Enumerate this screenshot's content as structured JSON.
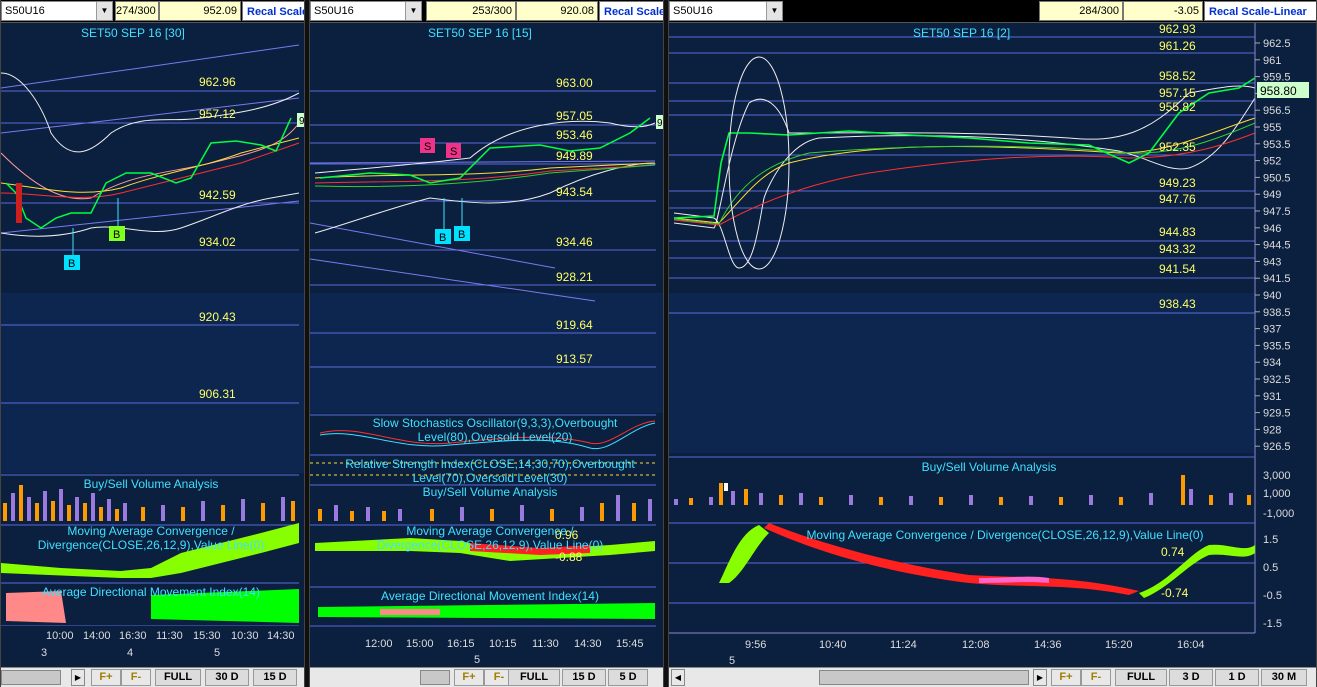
{
  "colors": {
    "background": "#0b1f3f",
    "grid_line": "#5a6ad8",
    "level_text": "#ffff66",
    "label_cyan": "#40e0ff",
    "price_line": "#00ff40",
    "bollinger": "#ffffff",
    "ma_yellow": "#ffdd33",
    "ma_red": "#ff3030",
    "ma_green": "#30d030",
    "volume_buy": "#ff9900",
    "volume_sell": "#9a7adf",
    "macd_green": "#88ff00",
    "macd_red": "#ff2020",
    "adx_green": "#00ff00",
    "adx_red": "#ff8888"
  },
  "panels": [
    {
      "id": "p1",
      "symbol": "S50U16",
      "bar_count": "274/300",
      "last_price": "952.09",
      "recal_label": "Recal Scale",
      "title": "SET50 SEP 16  [30]",
      "price_levels": [
        "962.96",
        "957.12",
        "942.59",
        "934.02",
        "920.43",
        "906.31"
      ],
      "badge_edge": "9",
      "markers": [
        "B",
        "B"
      ],
      "volume_label": "Buy/Sell Volume Analysis",
      "macd_label": "Moving Average Convergence / Divergence(CLOSE,26,12,9),Value Line(0)",
      "adx_label": "Average Directional Movement Index(14)",
      "time_labels": [
        "10:00",
        "14:00",
        "16:30",
        "11:30",
        "15:30",
        "10:30",
        "14:30"
      ],
      "date_labels": [
        "3",
        "4",
        "5"
      ],
      "buttons": [
        "F+",
        "F-",
        "FULL",
        "30 D",
        "15 D"
      ]
    },
    {
      "id": "p2",
      "symbol": "S50U16",
      "bar_count": "253/300",
      "last_price": "920.08",
      "recal_label": "Recal Scale",
      "title": "SET50 SEP 16  [15]",
      "price_levels": [
        "963.00",
        "957.05",
        "953.46",
        "949.89",
        "943.54",
        "934.46",
        "928.21",
        "919.64",
        "913.57"
      ],
      "badge_edge": "9",
      "markers": [
        "S",
        "S",
        "B",
        "B"
      ],
      "stoch_label": "Slow Stochastics Oscillator(9,3,3),Overbought Level(80),Oversold Level(20)",
      "rsi_label": "Relative Strength Index(CLOSE,14,30,70),Overbought Level(70),Oversold Level(30)",
      "volume_label": "Buy/Sell Volume Analysis",
      "macd_label": "Moving Average Convergence / Divergence(CLOSE,26,12,9),Value Line(0)",
      "macd_values": [
        "0.96",
        "-0.88"
      ],
      "adx_label": "Average Directional Movement Index(14)",
      "time_labels": [
        "12:00",
        "15:00",
        "16:15",
        "10:15",
        "11:30",
        "14:30",
        "15:45"
      ],
      "date_labels": [
        "5"
      ],
      "buttons": [
        "F+",
        "F-",
        "FULL",
        "15 D",
        "5 D"
      ]
    },
    {
      "id": "p3",
      "symbol": "S50U16",
      "bar_count": "284/300",
      "last_price": "-3.05",
      "recal_label": "Recal Scale-Linear",
      "title": "SET50 SEP 16  [2]",
      "price_levels": [
        "962.93",
        "961.26",
        "958.52",
        "957.15",
        "955.82",
        "952.35",
        "949.23",
        "947.76",
        "944.83",
        "943.32",
        "941.54",
        "938.43"
      ],
      "current_price": "958.80",
      "axis_ticks": [
        "962.5",
        "961",
        "959.5",
        "958",
        "956.5",
        "955",
        "953.5",
        "952",
        "950.5",
        "949",
        "947.5",
        "946",
        "944.5",
        "943",
        "941.5",
        "940",
        "938.5",
        "937",
        "935.5",
        "934",
        "932.5",
        "931",
        "929.5",
        "928",
        "926.5"
      ],
      "volume_label": "Buy/Sell Volume Analysis",
      "volume_ticks": [
        "3,000",
        "1,000",
        "-1,000"
      ],
      "macd_label": "Moving Average Convergence / Divergence(CLOSE,26,12,9),Value Line(0)",
      "macd_values": [
        "0.74",
        "-0.74"
      ],
      "macd_ticks": [
        "1.5",
        "0.5",
        "-0.5",
        "-1.5"
      ],
      "time_labels": [
        "9:56",
        "10:40",
        "11:24",
        "12:08",
        "14:36",
        "15:20",
        "16:04"
      ],
      "date_labels": [
        "5"
      ],
      "buttons": [
        "F+",
        "F-",
        "FULL",
        "3 D",
        "1 D",
        "30 M"
      ]
    }
  ]
}
